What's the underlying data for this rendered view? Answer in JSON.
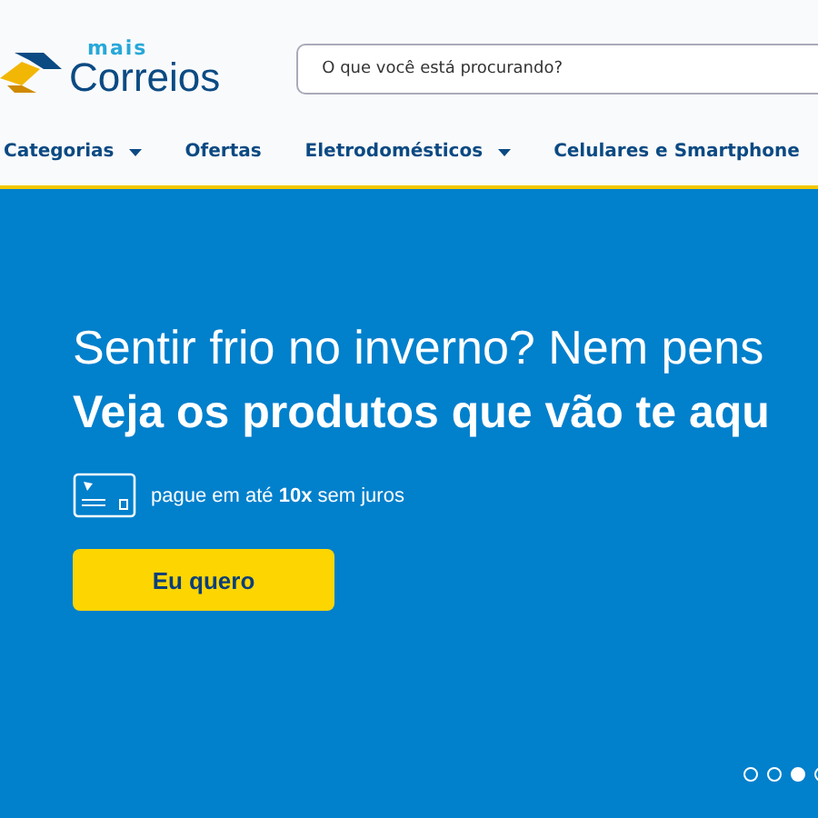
{
  "logo": {
    "small": "mais",
    "name": "Correios"
  },
  "search": {
    "placeholder": "O que você está procurando?"
  },
  "nav": [
    {
      "label": "Categorias",
      "dropdown": true
    },
    {
      "label": "Ofertas",
      "dropdown": false
    },
    {
      "label": "Eletrodomésticos",
      "dropdown": true
    },
    {
      "label": "Celulares e Smartphone",
      "dropdown": false
    }
  ],
  "hero": {
    "headline": "Sentir frio no inverno? Nem pens",
    "subheadline": "Veja os produtos que vão te aqu",
    "payment": "pague em até **10x** sem juros",
    "button": "Eu quero"
  },
  "carousel": [
    {
      "selected": false
    },
    {
      "selected": false
    },
    {
      "selected": true
    },
    {
      "selected": false
    }
  ]
}
